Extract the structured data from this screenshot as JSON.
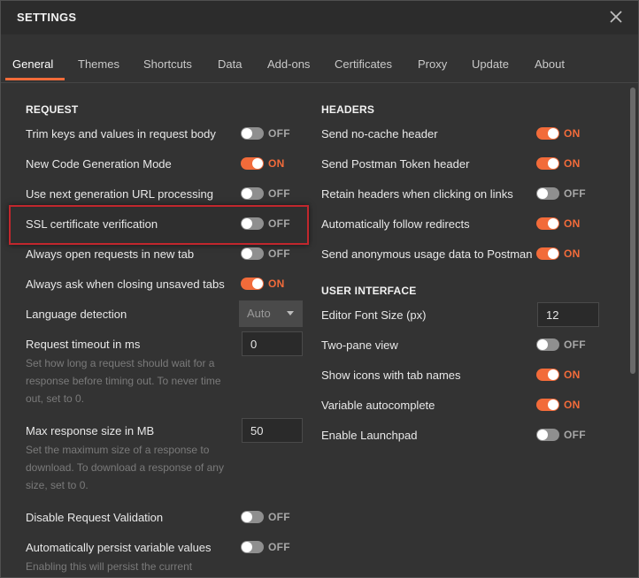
{
  "window": {
    "title": "SETTINGS"
  },
  "tabs": [
    {
      "label": "General",
      "active": true
    },
    {
      "label": "Themes"
    },
    {
      "label": "Shortcuts"
    },
    {
      "label": "Data"
    },
    {
      "label": "Add-ons"
    },
    {
      "label": "Certificates"
    },
    {
      "label": "Proxy"
    },
    {
      "label": "Update"
    },
    {
      "label": "About"
    }
  ],
  "request": {
    "section_title": "REQUEST",
    "trim_keys": {
      "label": "Trim keys and values in request body",
      "state": "OFF"
    },
    "new_codegen": {
      "label": "New Code Generation Mode",
      "state": "ON"
    },
    "next_gen_url": {
      "label": "Use next generation URL processing",
      "state": "OFF"
    },
    "ssl_verification": {
      "label": "SSL certificate verification",
      "state": "OFF"
    },
    "open_new_tab": {
      "label": "Always open requests in new tab",
      "state": "OFF"
    },
    "ask_closing": {
      "label": "Always ask when closing unsaved tabs",
      "state": "ON"
    },
    "language_detection": {
      "label": "Language detection",
      "value": "Auto"
    },
    "timeout": {
      "label": "Request timeout in ms",
      "value": "0",
      "help": "Set how long a request should wait for a response before timing out. To never time out, set to 0."
    },
    "max_response": {
      "label": "Max response size in MB",
      "value": "50",
      "help": "Set the maximum size of a response to download. To download a response of any size, set to 0."
    },
    "disable_validation": {
      "label": "Disable Request Validation",
      "state": "OFF"
    },
    "persist_variables": {
      "label": "Automatically persist variable values",
      "state": "OFF",
      "help": "Enabling this will persist the current"
    }
  },
  "headers": {
    "section_title": "HEADERS",
    "no_cache": {
      "label": "Send no-cache header",
      "state": "ON"
    },
    "postman_token": {
      "label": "Send Postman Token header",
      "state": "ON"
    },
    "retain_headers": {
      "label": "Retain headers when clicking on links",
      "state": "OFF"
    },
    "follow_redirects": {
      "label": "Automatically follow redirects",
      "state": "ON"
    },
    "anonymous_usage": {
      "label": "Send anonymous usage data to Postman",
      "state": "ON"
    }
  },
  "ui": {
    "section_title": "USER INTERFACE",
    "font_size": {
      "label": "Editor Font Size (px)",
      "value": "12"
    },
    "two_pane": {
      "label": "Two-pane view",
      "state": "OFF"
    },
    "icons_tabs": {
      "label": "Show icons with tab names",
      "state": "ON"
    },
    "var_autocomplete": {
      "label": "Variable autocomplete",
      "state": "ON"
    },
    "launchpad": {
      "label": "Enable Launchpad",
      "state": "OFF"
    }
  },
  "colors": {
    "accent": "#f26b3a",
    "highlight_border": "#c1272d",
    "background": "#333333"
  },
  "icons": {
    "close": "close-icon",
    "caret": "chevron-down-icon"
  }
}
